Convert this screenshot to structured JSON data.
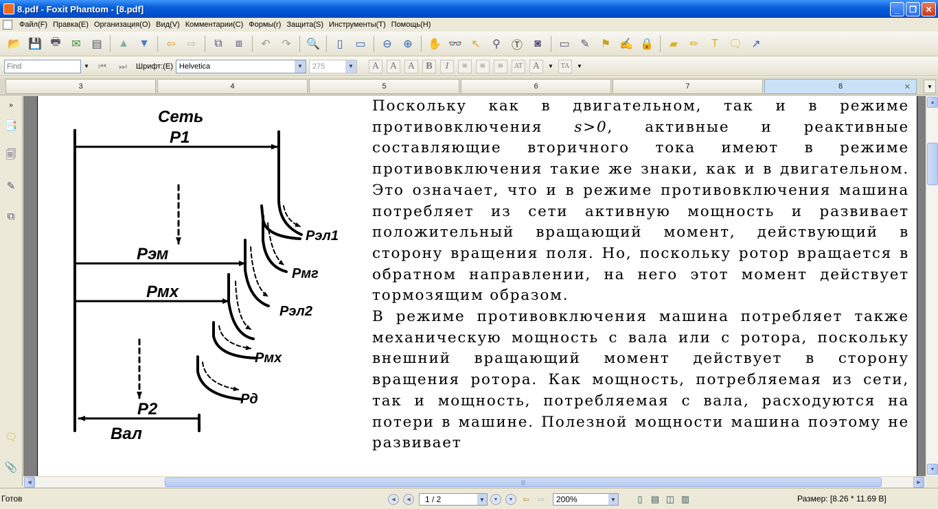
{
  "window": {
    "title": "8.pdf - Foxit Phantom - [8.pdf]"
  },
  "menu": [
    "Файл(F)",
    "Правка(E)",
    "Организация(O)",
    "Вид(V)",
    "Комментарии(C)",
    "Формы(r)",
    "Защита(S)",
    "Инструменты(T)",
    "Помощь(H)"
  ],
  "toolbar2": {
    "find_placeholder": "Find",
    "font_label": "Шрифт:(E)",
    "font_name": "Helvetica",
    "font_size": "275"
  },
  "tabs": [
    "3",
    "4",
    "5",
    "6",
    "7",
    "8"
  ],
  "diagram": {
    "labels": {
      "set": "Сеть",
      "p1": "P1",
      "pel1": "Pэл1",
      "pem": "Pэм",
      "pmg": "Pмг",
      "pmx": "Pмх",
      "pel2": "Pэл2",
      "pmx2": "Pмх",
      "pd": "Pд",
      "p2": "P2",
      "val": "Вал"
    }
  },
  "document": {
    "para1_before": "Поскольку как в двигательном, так и в режиме противовключения ",
    "para1_math": "s>0",
    "para1_after": ", активные и реактивные составляющие вторичного тока имеют в режиме противовключения такие же знаки, как и в двигательном. Это означает, что и в режиме противовключения машина потребляет из сети ак­тивную мощность и развивает положительный вращающий момент, действующий в сторону вращения поля. Но, поскольку ротор вращается в обратном направлении, на него этот момент действует тор­мозящим образом.",
    "para2": "В режиме противовключения машина потребляет также механическую мощность с вала или с ротора, поскольку внешний вращающий момент действует в сторону вращения ротора. Как мощность, потребляемая из сети, так и мощность, потребляемая с вала, расходуются на потери в машине. Полезной мощности машина поэтому не развивает"
  },
  "status": {
    "ready": "Готов",
    "page": "1 / 2",
    "zoom": "200%",
    "size": "Размер: [8.26 * 11.69 В]"
  }
}
